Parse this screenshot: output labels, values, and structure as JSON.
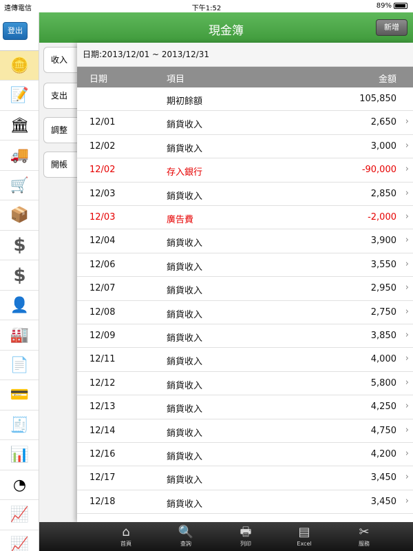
{
  "status": {
    "carrier": "遠傳電信",
    "time": "下午1:52",
    "battery": "89%"
  },
  "sidebar": {
    "logout_label": "登出",
    "icons": [
      "coins-icon",
      "form-edit-icon",
      "bank-icon",
      "delivery-truck-icon",
      "inventory-cart-icon",
      "boxes-icon",
      "dollar-in-icon",
      "dollar-out-icon",
      "person-icon",
      "factory-icon",
      "document-box-icon",
      "credit-card-icon",
      "coins-document-icon",
      "bar-chart-icon",
      "pie-chart-icon",
      "line-chart-icon",
      "trend-chart-icon"
    ]
  },
  "header": {
    "title": "現金簿",
    "add_label": "新增"
  },
  "tabs": [
    "收入",
    "支出",
    "調整",
    "開帳"
  ],
  "date_range": "日期:2013/12/01 ~ 2013/12/31",
  "table": {
    "headers": {
      "date": "日期",
      "item": "項目",
      "amount": "金額"
    },
    "rows": [
      {
        "date": "",
        "item": "期初餘額",
        "amount": "105,850",
        "neg": false,
        "chev": false
      },
      {
        "date": "12/01",
        "item": "銷貨收入",
        "amount": "2,650",
        "neg": false,
        "chev": true
      },
      {
        "date": "12/02",
        "item": "銷貨收入",
        "amount": "3,000",
        "neg": false,
        "chev": true
      },
      {
        "date": "12/02",
        "item": "存入銀行",
        "amount": "-90,000",
        "neg": true,
        "chev": true
      },
      {
        "date": "12/03",
        "item": "銷貨收入",
        "amount": "2,850",
        "neg": false,
        "chev": true
      },
      {
        "date": "12/03",
        "item": "廣告費",
        "amount": "-2,000",
        "neg": true,
        "chev": true
      },
      {
        "date": "12/04",
        "item": "銷貨收入",
        "amount": "3,900",
        "neg": false,
        "chev": true
      },
      {
        "date": "12/06",
        "item": "銷貨收入",
        "amount": "3,550",
        "neg": false,
        "chev": true
      },
      {
        "date": "12/07",
        "item": "銷貨收入",
        "amount": "2,950",
        "neg": false,
        "chev": true
      },
      {
        "date": "12/08",
        "item": "銷貨收入",
        "amount": "2,750",
        "neg": false,
        "chev": true
      },
      {
        "date": "12/09",
        "item": "銷貨收入",
        "amount": "3,850",
        "neg": false,
        "chev": true
      },
      {
        "date": "12/11",
        "item": "銷貨收入",
        "amount": "4,000",
        "neg": false,
        "chev": true
      },
      {
        "date": "12/12",
        "item": "銷貨收入",
        "amount": "5,800",
        "neg": false,
        "chev": true
      },
      {
        "date": "12/13",
        "item": "銷貨收入",
        "amount": "4,250",
        "neg": false,
        "chev": true
      },
      {
        "date": "12/14",
        "item": "銷貨收入",
        "amount": "4,750",
        "neg": false,
        "chev": true
      },
      {
        "date": "12/16",
        "item": "銷貨收入",
        "amount": "4,200",
        "neg": false,
        "chev": true
      },
      {
        "date": "12/17",
        "item": "銷貨收入",
        "amount": "3,450",
        "neg": false,
        "chev": true
      },
      {
        "date": "12/18",
        "item": "銷貨收入",
        "amount": "3,450",
        "neg": false,
        "chev": true
      }
    ]
  },
  "bottom_bar": [
    {
      "label": "首頁",
      "icon": "home-icon"
    },
    {
      "label": "查詢",
      "icon": "search-document-icon"
    },
    {
      "label": "列印",
      "icon": "printer-icon"
    },
    {
      "label": "Excel",
      "icon": "excel-icon"
    },
    {
      "label": "服務",
      "icon": "tools-icon"
    }
  ],
  "colors": {
    "header_green": "#4aa846",
    "negative_red": "#e60000",
    "active_nav": "#f9e9a8"
  }
}
